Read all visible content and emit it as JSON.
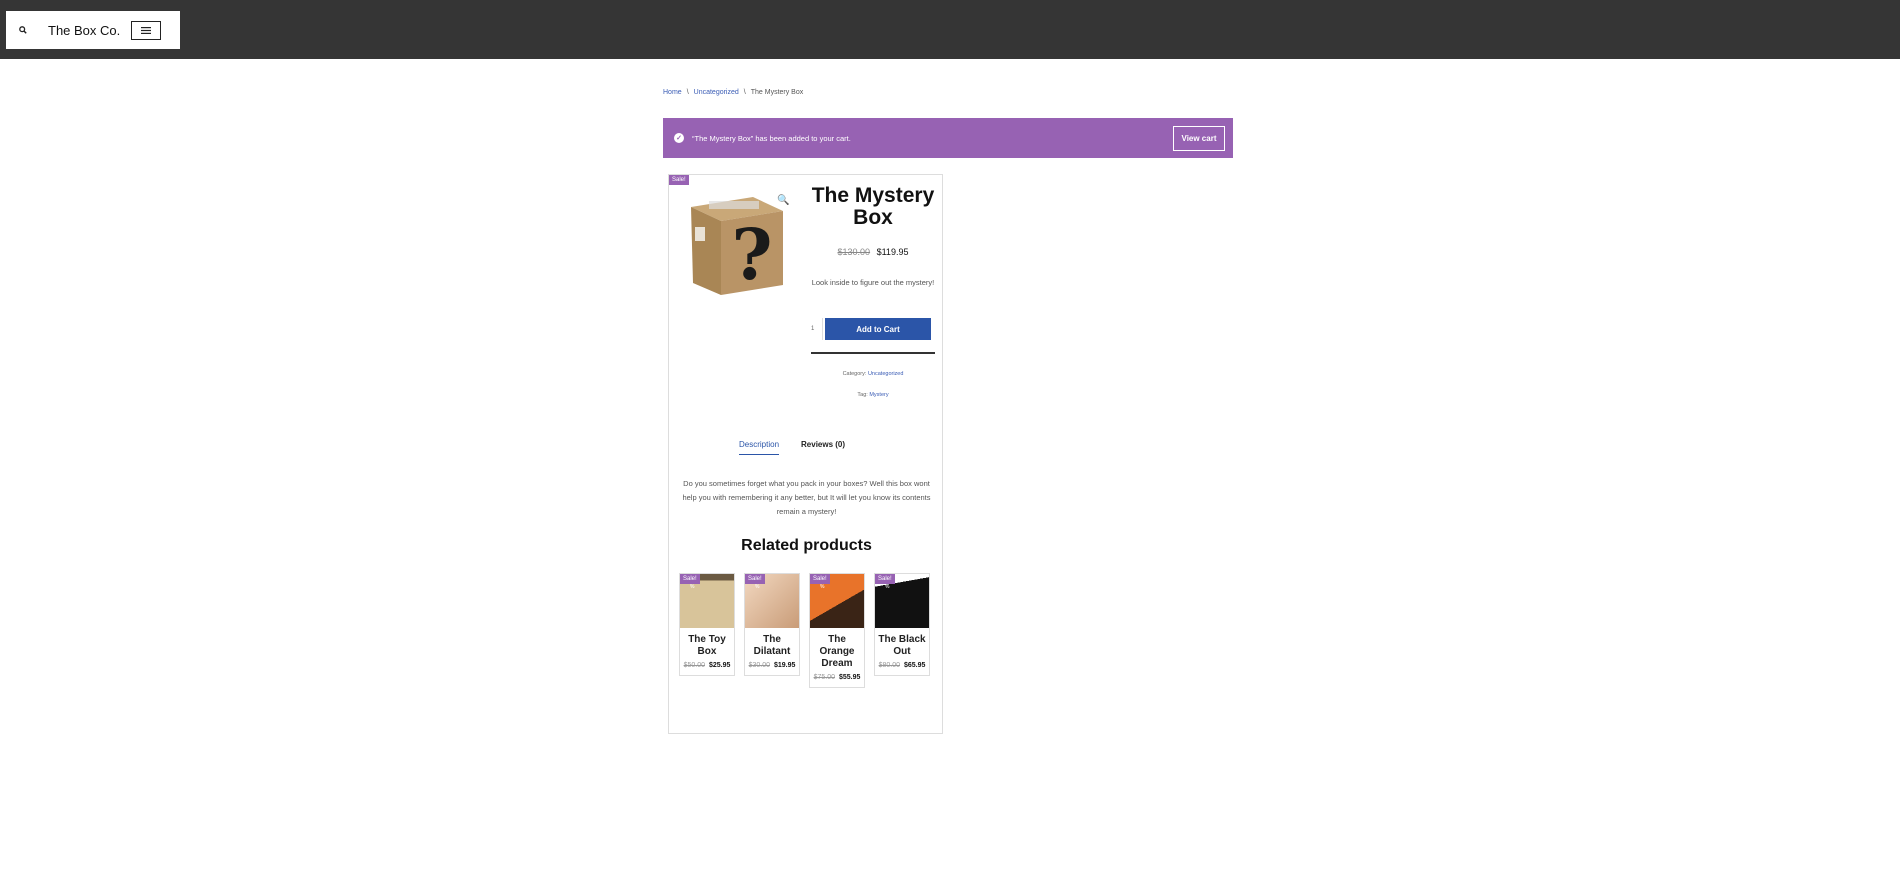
{
  "header": {
    "site_title": "The Box Co."
  },
  "breadcrumb": {
    "home": "Home",
    "category": "Uncategorized",
    "current": "The Mystery Box",
    "separator": "\\"
  },
  "notice": {
    "message": "“The Mystery Box” has been added to your cart.",
    "button": "View cart"
  },
  "product": {
    "sale_badge": "Sale!",
    "title": "The Mystery Box",
    "price_old": "$130.00",
    "price_new": "$119.95",
    "short_description": "Look inside to figure out the mystery!",
    "quantity": "1",
    "add_to_cart": "Add to Cart",
    "category_label": "Category:",
    "category_value": "Uncategorized",
    "tag_label": "Tag:",
    "tag_value": "Mystery"
  },
  "tabs": {
    "description": "Description",
    "reviews": "Reviews (0)"
  },
  "description_text": "Do you sometimes forget what you pack in your boxes? Well this box wont help you with remembering it any better, but It will let you know its contents remain a mystery!",
  "related": {
    "heading": "Related products",
    "items": [
      {
        "name": "The Toy Box",
        "sale": "Sale!",
        "pct": "%",
        "old": "$50.00",
        "new": "$25.95"
      },
      {
        "name": "The Dilatant",
        "sale": "Sale!",
        "pct": "%",
        "old": "$30.00",
        "new": "$19.95"
      },
      {
        "name": "The Orange Dream",
        "sale": "Sale!",
        "pct": "%",
        "old": "$75.00",
        "new": "$55.95"
      },
      {
        "name": "The Black Out",
        "sale": "Sale!",
        "pct": "%",
        "old": "$80.00",
        "new": "$65.95"
      }
    ]
  },
  "colors": {
    "header_bg": "#353535",
    "notice_bg": "#9762b3",
    "button_blue": "#2b55a8"
  }
}
